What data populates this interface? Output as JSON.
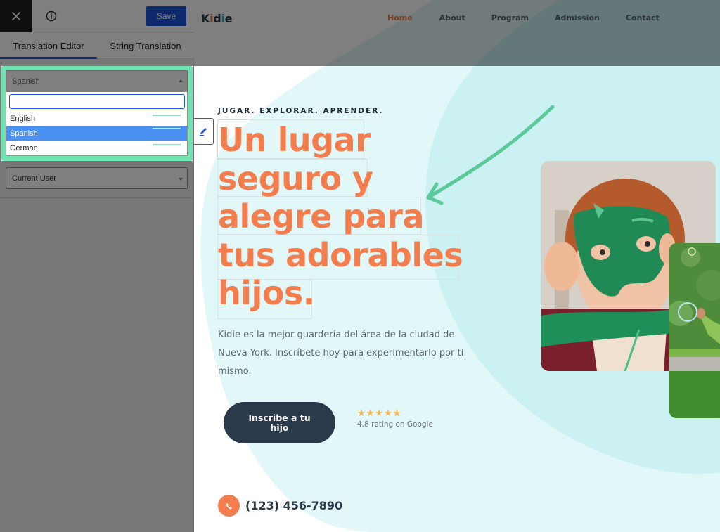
{
  "editor": {
    "topbar": {
      "close_icon": "close-icon",
      "info_icon": "info-icon",
      "save_label": "Save"
    },
    "tabs": [
      {
        "label": "Translation Editor",
        "active": true
      },
      {
        "label": "String Translation",
        "active": false
      }
    ],
    "language_select": {
      "value": "Spanish",
      "search_value": "",
      "options": [
        {
          "label": "English",
          "selected": false
        },
        {
          "label": "Spanish",
          "selected": true
        },
        {
          "label": "German",
          "selected": false
        }
      ]
    },
    "user_select": {
      "value": "Current User"
    },
    "highlight_color": "#6ce3b0",
    "accent_color": "#1e55d8"
  },
  "site": {
    "logo": {
      "part1": "K",
      "part2": "i",
      "part3": "d",
      "part4": "i",
      "part5": "e"
    },
    "nav": [
      {
        "label": "Home",
        "active": true
      },
      {
        "label": "About",
        "active": false
      },
      {
        "label": "Program",
        "active": false
      },
      {
        "label": "Admission",
        "active": false
      },
      {
        "label": "Contact",
        "active": false
      }
    ],
    "hero": {
      "eyebrow": "JUGAR. EXPLORAR. APRENDER.",
      "headline_lines": [
        "Un lugar",
        "seguro y",
        "alegre para",
        "tus adorables",
        "hijos."
      ],
      "description": "Kidie es la mejor guardería del área de la ciudad de Nueva York. Inscríbete hoy para experimentarlo por ti mismo.",
      "cta_label": "Inscribe a tu hijo",
      "stars": "★★★★★",
      "rating_text": "4.8 rating on Google",
      "phone": "(123) 456-7890"
    },
    "colors": {
      "brand_orange": "#f47d4e",
      "dark": "#2b3a48",
      "bg_mint": "#ccf3f3",
      "arrow_green": "#5cc99b"
    }
  }
}
